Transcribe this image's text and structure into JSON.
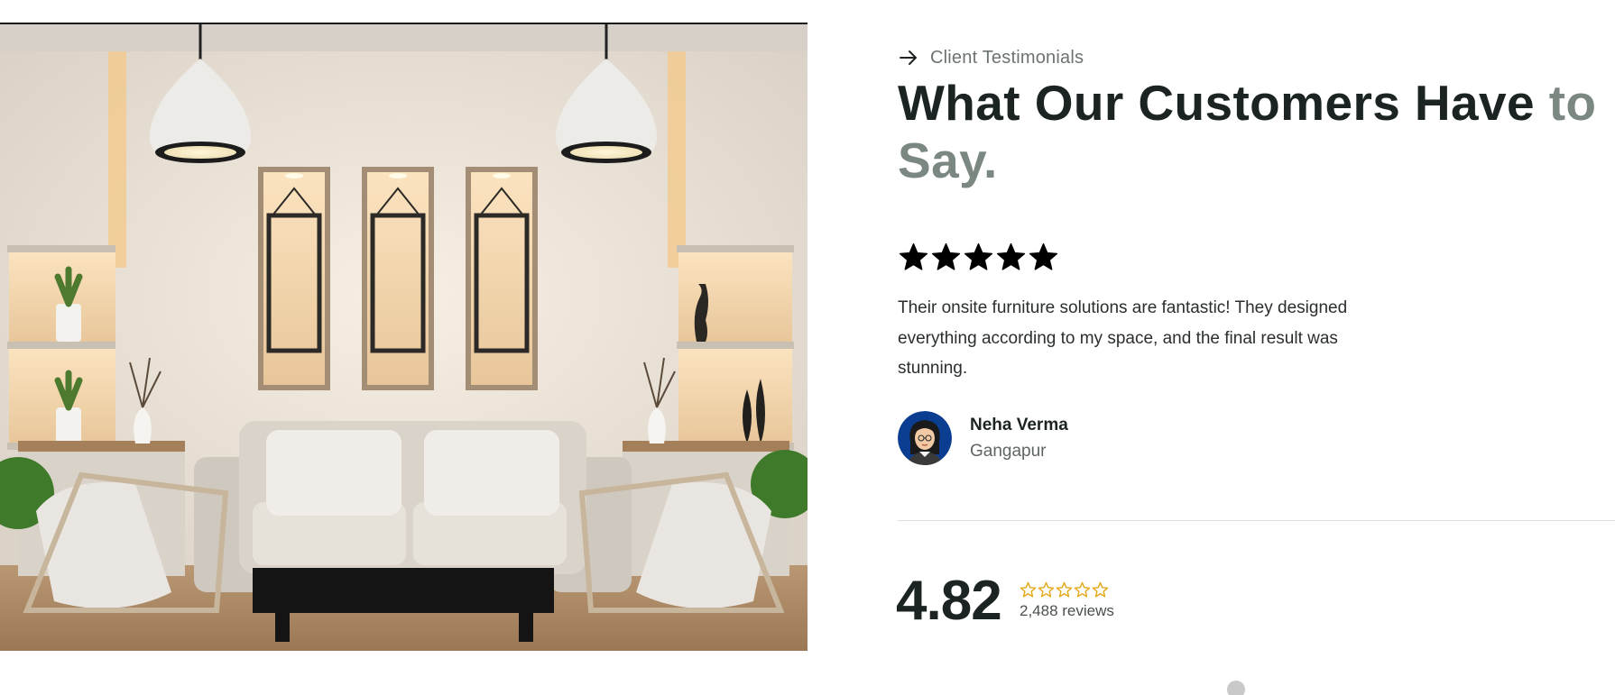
{
  "section": {
    "eyebrow_icon": "arrow-right-icon",
    "eyebrow": "Client Testimonials",
    "headline_dark": "What Our Customers Have",
    "headline_muted": "to",
    "headline_line2": "Say."
  },
  "testimonial": {
    "rating_icon": "star-filled-icon",
    "rating": 5,
    "quote": "Their onsite furniture solutions are fantastic! They designed everything according to my space, and the final result was stunning.",
    "author_name": "Neha Verma",
    "author_location": "Gangapur"
  },
  "summary": {
    "score": "4.82",
    "star_icon": "star-outline-icon",
    "star_count": 5,
    "reviews": "2,488 reviews"
  },
  "colors": {
    "text_dark": "#1b2422",
    "text_muted": "#7b8781",
    "star_gold": "#e5a91b",
    "avatar_bg": "#0b3d91"
  }
}
